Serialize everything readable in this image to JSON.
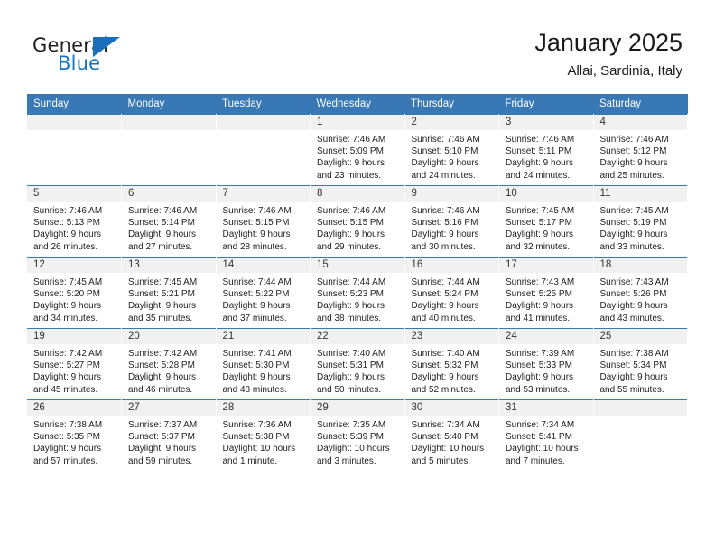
{
  "brand": {
    "name_part1": "General",
    "name_part2": "Blue",
    "triangle_color": "#1a6fba",
    "blue_text_color": "#1a74bb"
  },
  "header": {
    "title": "January 2025",
    "location": "Allai, Sardinia, Italy"
  },
  "theme": {
    "header_blue": "#3878b4",
    "daynum_band": "#f1f1f1",
    "page_background": "#ffffff"
  },
  "weekday_headers": [
    "Sunday",
    "Monday",
    "Tuesday",
    "Wednesday",
    "Thursday",
    "Friday",
    "Saturday"
  ],
  "labels": {
    "sunrise_prefix": "Sunrise:",
    "sunset_prefix": "Sunset:",
    "daylight_prefix": "Daylight:"
  },
  "weeks": [
    [
      {
        "day": "",
        "line1": "",
        "line2": "",
        "line3": "",
        "line4": ""
      },
      {
        "day": "",
        "line1": "",
        "line2": "",
        "line3": "",
        "line4": ""
      },
      {
        "day": "",
        "line1": "",
        "line2": "",
        "line3": "",
        "line4": ""
      },
      {
        "day": "1",
        "line1": "Sunrise: 7:46 AM",
        "line2": "Sunset: 5:09 PM",
        "line3": "Daylight: 9 hours",
        "line4": "and 23 minutes."
      },
      {
        "day": "2",
        "line1": "Sunrise: 7:46 AM",
        "line2": "Sunset: 5:10 PM",
        "line3": "Daylight: 9 hours",
        "line4": "and 24 minutes."
      },
      {
        "day": "3",
        "line1": "Sunrise: 7:46 AM",
        "line2": "Sunset: 5:11 PM",
        "line3": "Daylight: 9 hours",
        "line4": "and 24 minutes."
      },
      {
        "day": "4",
        "line1": "Sunrise: 7:46 AM",
        "line2": "Sunset: 5:12 PM",
        "line3": "Daylight: 9 hours",
        "line4": "and 25 minutes."
      }
    ],
    [
      {
        "day": "5",
        "line1": "Sunrise: 7:46 AM",
        "line2": "Sunset: 5:13 PM",
        "line3": "Daylight: 9 hours",
        "line4": "and 26 minutes."
      },
      {
        "day": "6",
        "line1": "Sunrise: 7:46 AM",
        "line2": "Sunset: 5:14 PM",
        "line3": "Daylight: 9 hours",
        "line4": "and 27 minutes."
      },
      {
        "day": "7",
        "line1": "Sunrise: 7:46 AM",
        "line2": "Sunset: 5:15 PM",
        "line3": "Daylight: 9 hours",
        "line4": "and 28 minutes."
      },
      {
        "day": "8",
        "line1": "Sunrise: 7:46 AM",
        "line2": "Sunset: 5:15 PM",
        "line3": "Daylight: 9 hours",
        "line4": "and 29 minutes."
      },
      {
        "day": "9",
        "line1": "Sunrise: 7:46 AM",
        "line2": "Sunset: 5:16 PM",
        "line3": "Daylight: 9 hours",
        "line4": "and 30 minutes."
      },
      {
        "day": "10",
        "line1": "Sunrise: 7:45 AM",
        "line2": "Sunset: 5:17 PM",
        "line3": "Daylight: 9 hours",
        "line4": "and 32 minutes."
      },
      {
        "day": "11",
        "line1": "Sunrise: 7:45 AM",
        "line2": "Sunset: 5:19 PM",
        "line3": "Daylight: 9 hours",
        "line4": "and 33 minutes."
      }
    ],
    [
      {
        "day": "12",
        "line1": "Sunrise: 7:45 AM",
        "line2": "Sunset: 5:20 PM",
        "line3": "Daylight: 9 hours",
        "line4": "and 34 minutes."
      },
      {
        "day": "13",
        "line1": "Sunrise: 7:45 AM",
        "line2": "Sunset: 5:21 PM",
        "line3": "Daylight: 9 hours",
        "line4": "and 35 minutes."
      },
      {
        "day": "14",
        "line1": "Sunrise: 7:44 AM",
        "line2": "Sunset: 5:22 PM",
        "line3": "Daylight: 9 hours",
        "line4": "and 37 minutes."
      },
      {
        "day": "15",
        "line1": "Sunrise: 7:44 AM",
        "line2": "Sunset: 5:23 PM",
        "line3": "Daylight: 9 hours",
        "line4": "and 38 minutes."
      },
      {
        "day": "16",
        "line1": "Sunrise: 7:44 AM",
        "line2": "Sunset: 5:24 PM",
        "line3": "Daylight: 9 hours",
        "line4": "and 40 minutes."
      },
      {
        "day": "17",
        "line1": "Sunrise: 7:43 AM",
        "line2": "Sunset: 5:25 PM",
        "line3": "Daylight: 9 hours",
        "line4": "and 41 minutes."
      },
      {
        "day": "18",
        "line1": "Sunrise: 7:43 AM",
        "line2": "Sunset: 5:26 PM",
        "line3": "Daylight: 9 hours",
        "line4": "and 43 minutes."
      }
    ],
    [
      {
        "day": "19",
        "line1": "Sunrise: 7:42 AM",
        "line2": "Sunset: 5:27 PM",
        "line3": "Daylight: 9 hours",
        "line4": "and 45 minutes."
      },
      {
        "day": "20",
        "line1": "Sunrise: 7:42 AM",
        "line2": "Sunset: 5:28 PM",
        "line3": "Daylight: 9 hours",
        "line4": "and 46 minutes."
      },
      {
        "day": "21",
        "line1": "Sunrise: 7:41 AM",
        "line2": "Sunset: 5:30 PM",
        "line3": "Daylight: 9 hours",
        "line4": "and 48 minutes."
      },
      {
        "day": "22",
        "line1": "Sunrise: 7:40 AM",
        "line2": "Sunset: 5:31 PM",
        "line3": "Daylight: 9 hours",
        "line4": "and 50 minutes."
      },
      {
        "day": "23",
        "line1": "Sunrise: 7:40 AM",
        "line2": "Sunset: 5:32 PM",
        "line3": "Daylight: 9 hours",
        "line4": "and 52 minutes."
      },
      {
        "day": "24",
        "line1": "Sunrise: 7:39 AM",
        "line2": "Sunset: 5:33 PM",
        "line3": "Daylight: 9 hours",
        "line4": "and 53 minutes."
      },
      {
        "day": "25",
        "line1": "Sunrise: 7:38 AM",
        "line2": "Sunset: 5:34 PM",
        "line3": "Daylight: 9 hours",
        "line4": "and 55 minutes."
      }
    ],
    [
      {
        "day": "26",
        "line1": "Sunrise: 7:38 AM",
        "line2": "Sunset: 5:35 PM",
        "line3": "Daylight: 9 hours",
        "line4": "and 57 minutes."
      },
      {
        "day": "27",
        "line1": "Sunrise: 7:37 AM",
        "line2": "Sunset: 5:37 PM",
        "line3": "Daylight: 9 hours",
        "line4": "and 59 minutes."
      },
      {
        "day": "28",
        "line1": "Sunrise: 7:36 AM",
        "line2": "Sunset: 5:38 PM",
        "line3": "Daylight: 10 hours",
        "line4": "and 1 minute."
      },
      {
        "day": "29",
        "line1": "Sunrise: 7:35 AM",
        "line2": "Sunset: 5:39 PM",
        "line3": "Daylight: 10 hours",
        "line4": "and 3 minutes."
      },
      {
        "day": "30",
        "line1": "Sunrise: 7:34 AM",
        "line2": "Sunset: 5:40 PM",
        "line3": "Daylight: 10 hours",
        "line4": "and 5 minutes."
      },
      {
        "day": "31",
        "line1": "Sunrise: 7:34 AM",
        "line2": "Sunset: 5:41 PM",
        "line3": "Daylight: 10 hours",
        "line4": "and 7 minutes."
      },
      {
        "day": "",
        "line1": "",
        "line2": "",
        "line3": "",
        "line4": ""
      }
    ]
  ]
}
